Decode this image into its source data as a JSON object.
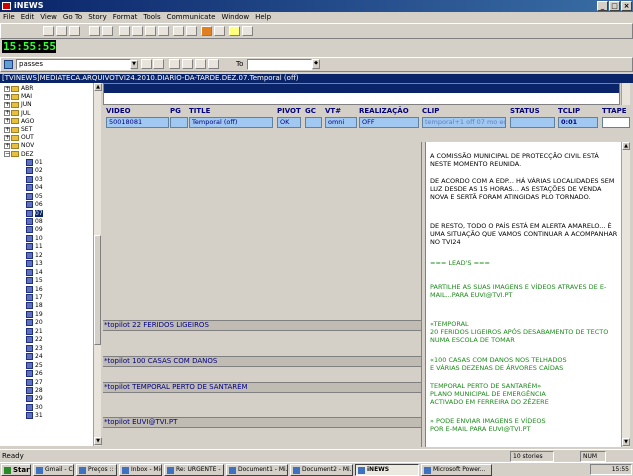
{
  "app": {
    "title": "iNEWS"
  },
  "menu": [
    "File",
    "Edit",
    "View",
    "Go To",
    "Story",
    "Format",
    "Tools",
    "Communicate",
    "Window",
    "Help"
  ],
  "clock": "15:55:55",
  "toolbar": {
    "queue_value": "passes",
    "to_label": "To"
  },
  "path_bar": "[TVINEWS]MEDIATECA.ARQUIVOTVI24.2010.DIARIO-DA-TARDE.DEZ.07.Temporal   (off)",
  "tree": {
    "months": [
      "ABR",
      "MAI",
      "JUN",
      "JUL",
      "AGO",
      "SET",
      "OUT",
      "NOV",
      "DEZ"
    ],
    "days": [
      "01",
      "02",
      "03",
      "04",
      "05",
      "06",
      "07",
      "08",
      "09",
      "10",
      "11",
      "12",
      "13",
      "14",
      "15",
      "16",
      "17",
      "18",
      "19",
      "20",
      "21",
      "22",
      "23",
      "24",
      "25",
      "26",
      "27",
      "28",
      "29",
      "30",
      "31"
    ],
    "selected_day": "07"
  },
  "story_form": {
    "headers": [
      "VIDEO",
      "PG",
      "TITLE",
      "PIVOT",
      "GC",
      "VT#",
      "REALIZAÇÃO",
      "CLIP",
      "STATUS",
      "TCLIP",
      "TTAPE"
    ],
    "values": {
      "video": "50018081",
      "pg": "",
      "title": "Temporal   (off)",
      "pivot": "OK",
      "gc": "",
      "vt": "omni",
      "realizacao": "OFF",
      "clip": "temporal+1 off 07 mo ed 1",
      "status": "",
      "tclip": "0:01",
      "ttape": ""
    }
  },
  "cg_bars": [
    "*topilot 22 FERIDOS LIGEIROS",
    "*topilot 100 CASAS COM DANOS",
    "*topilot TEMPORAL PERTO DE SANTARÉM",
    "*topilot EUVI@TVI.PT"
  ],
  "story_text": [
    {
      "text": "A COMISSÃO MUNICIPAL DE PROTECÇÃO CIVIL ESTÁ NESTE MOMENTO REUNIDA.",
      "color": "#000000"
    },
    {
      "text": "DE ACORDO COM A EDP... HÁ VÁRIAS LOCALIDADES SEM LUZ DESDE AS 15 HORAS... AS ESTAÇÕES DE VENDA NOVA E SERTÃ FORAM ATINGIDAS PLO TORNADO.",
      "color": "#000000"
    },
    {
      "text": "DE RESTO,  TODO O PAÍS ESTÁ EM ALERTA AMARELO... É UMA SITUAÇÃO QUE VAMOS CONTINUAR A ACOMPANHAR NO TVI24",
      "color": "#000000"
    },
    {
      "text": "=== LEAD'S ===",
      "color": "#1a8a1a"
    },
    {
      "text": "PARTILHE AS SUAS IMAGENS E VÍDEOS ATRAVES DE E-MAIL...PARA EUVI@TVI.PT",
      "color": "#1a8a1a"
    },
    {
      "text": "«TEMPORAL\n20 FERIDOS LIGEIROS APÓS DESABAMENTO DE TECTO NUMA ESCOLA DE TOMAR",
      "color": "#1a8a1a"
    },
    {
      "text": "«100 CASAS COM DANOS NOS TELHADOS\nE VÁRIAS DEZENAS DE ÁRVORES CAÍDAS",
      "color": "#1a8a1a"
    },
    {
      "text": "TEMPORAL PERTO DE SANTARÉM»\nPLANO MUNICIPAL DE EMERGÊNCIA\nACTIVADO EM FERREIRA DO ZÊZERE",
      "color": "#1a8a1a"
    },
    {
      "text": "» PODE ENVIAR IMAGENS E VÍDEOS\nPOR E-MAIL PARA EUVI@TVI.PT",
      "color": "#1a8a1a"
    }
  ],
  "status": {
    "left": "Ready",
    "count": "10 stories",
    "mode": "NUM"
  },
  "taskbar": {
    "start": "Start",
    "tasks": [
      "Gmail - Caixa d...",
      "Preços :: CP :: ...",
      "Inbox - Microso...",
      "Re: URGENTE - ...",
      "Document1 - Mi...",
      "Document2 - Mi...",
      "iNEWS",
      "Microsoft Power..."
    ],
    "time": "15:55"
  }
}
